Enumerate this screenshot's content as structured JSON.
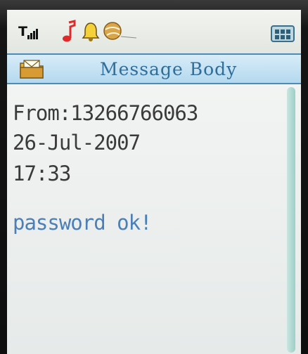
{
  "status_bar": {
    "signal_label": "T",
    "icons": [
      "signal-icon",
      "music-note-icon",
      "bell-icon",
      "ball-icon",
      "menu-grid-icon"
    ]
  },
  "title_bar": {
    "icon": "envelope-folder-icon",
    "title": "Message Body"
  },
  "message": {
    "from": "From:13266766063",
    "date": "26-Jul-2007",
    "time": "17:33",
    "text": "password ok!"
  },
  "colors": {
    "title_text": "#2f6e9a",
    "message_text": "#4a7fb8",
    "body_text": "#3a3a3a"
  }
}
